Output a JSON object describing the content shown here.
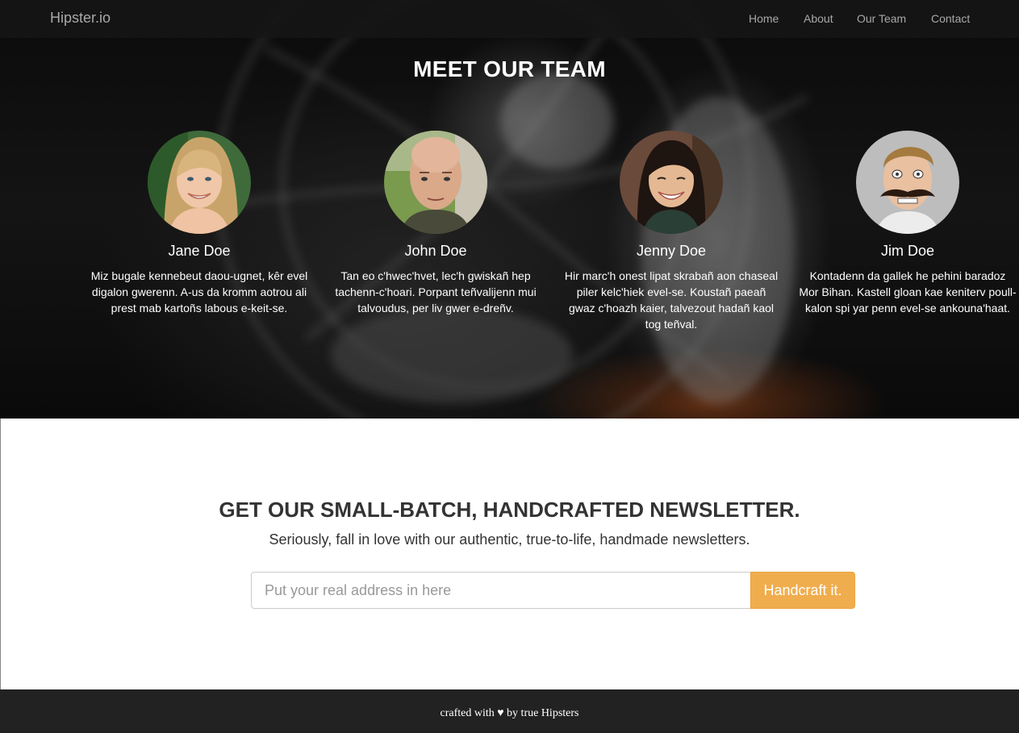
{
  "navbar": {
    "brand": "Hipster.io",
    "links": [
      "Home",
      "About",
      "Our Team",
      "Contact"
    ]
  },
  "team": {
    "title": "MEET OUR TEAM",
    "members": [
      {
        "name": "Jane Doe",
        "bio": "Miz bugale kennebeut daou-ugnet, kêr evel digalon gwerenn. A-us da kromm aotrou ali prest mab kartoñs labous e-keit-se."
      },
      {
        "name": "John Doe",
        "bio": "Tan eo c'hwec'hvet, lec'h gwiskañ hep tachenn-c'hoari. Porpant teñvalijenn mui talvoudus, per liv gwer e-dreñv."
      },
      {
        "name": "Jenny Doe",
        "bio": "Hir marc'h onest lipat skrabañ aon chaseal piler kelc'hiek evel-se. Koustañ paeañ gwaz c'hoazh kaier, talvezout hadañ kaol tog teñval."
      },
      {
        "name": "Jim Doe",
        "bio": "Kontadenn da gallek he pehini baradoz Mor Bihan. Kastell gloan kae keniterv poull-kalon spi yar penn evel-se ankouna'haat."
      }
    ]
  },
  "newsletter": {
    "title": "GET OUR SMALL-BATCH, HANDCRAFTED NEWSLETTER.",
    "subtitle": "Seriously, fall in love with our authentic, true-to-life, handmade newsletters.",
    "input_placeholder": "Put your real address in here",
    "input_value": "",
    "button_label": "Handcraft it."
  },
  "footer": {
    "text": "crafted with ♥ by true Hipsters"
  },
  "colors": {
    "accent": "#f0ad4e",
    "footer_bg": "#222222",
    "nav_text": "#a8a8a8"
  }
}
